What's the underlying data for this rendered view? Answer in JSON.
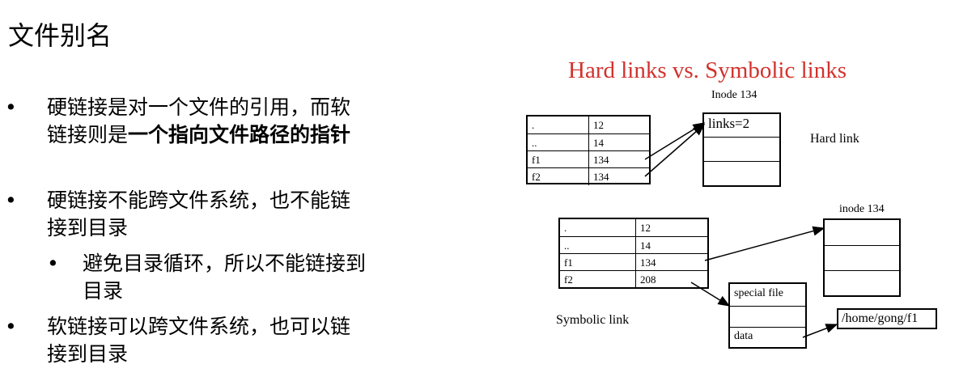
{
  "slide": {
    "title": "文件别名",
    "bullets": [
      {
        "marker": "•",
        "line1": "硬链接是对一个文件的引用，而软",
        "line2_plain": "链接则是",
        "line2_bold": "一个指向文件路径的指针"
      },
      {
        "marker": "•",
        "line1": "硬链接不能跨文件系统，也不能链",
        "line2": "接到目录"
      },
      {
        "marker": "•",
        "line1": "避免目录循环，所以不能链接到",
        "line2": "目录"
      },
      {
        "marker": "•",
        "line1": "软链接可以跨文件系统，也可以链",
        "line2": "接到目录"
      }
    ]
  },
  "diagram": {
    "title": "Hard links vs. Symbolic links",
    "hard": {
      "inode_label": "Inode 134",
      "inode_slot1": "links=2",
      "caption": "Hard link",
      "rows": [
        {
          "name": ".",
          "value": "12"
        },
        {
          "name": "..",
          "value": "14"
        },
        {
          "name": "f1",
          "value": "134"
        },
        {
          "name": "f2",
          "value": "134"
        }
      ]
    },
    "symbolic": {
      "inode_label": "inode 134",
      "caption": "Symbolic link",
      "special_file": "special file",
      "data": "data",
      "path": "/home/gong/f1",
      "rows": [
        {
          "name": ".",
          "value": "12"
        },
        {
          "name": "..",
          "value": "14"
        },
        {
          "name": "f1",
          "value": "134"
        },
        {
          "name": "f2",
          "value": "208"
        }
      ]
    }
  }
}
